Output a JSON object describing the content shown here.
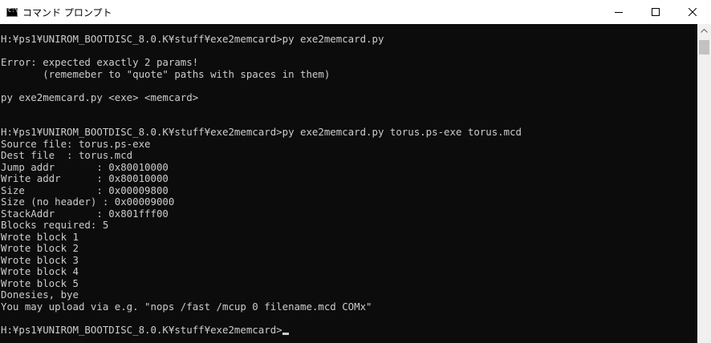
{
  "window": {
    "title": "コマンド プロンプト",
    "icon": "cmd-icon",
    "controls": [
      "minimize-icon",
      "maximize-icon",
      "close-icon"
    ]
  },
  "console": {
    "lines": [
      "H:¥ps1¥UNIROM_BOOTDISC_8.0.K¥stuff¥exe2memcard>py exe2memcard.py",
      "",
      "Error: expected exactly 2 params!",
      "       (rememeber to \"quote\" paths with spaces in them)",
      "",
      "py exe2memcard.py <exe> <memcard>",
      "",
      "",
      "H:¥ps1¥UNIROM_BOOTDISC_8.0.K¥stuff¥exe2memcard>py exe2memcard.py torus.ps-exe torus.mcd",
      "Source file: torus.ps-exe",
      "Dest file  : torus.mcd",
      "Jump addr       : 0x80010000",
      "Write addr      : 0x80010000",
      "Size            : 0x00009800",
      "Size (no header) : 0x00009000",
      "StackAddr       : 0x801fff00",
      "Blocks required: 5",
      "Wrote block 1",
      "Wrote block 2",
      "Wrote block 3",
      "Wrote block 4",
      "Wrote block 5",
      "Donesies, bye",
      "You may upload via e.g. \"nops /fast /mcup 0 filename.mcd COMx\"",
      "",
      "H:¥ps1¥UNIROM_BOOTDISC_8.0.K¥stuff¥exe2memcard>"
    ]
  },
  "colors": {
    "background": "#0c0c0c",
    "text": "#cccccc",
    "titlebar": "#ffffff"
  }
}
